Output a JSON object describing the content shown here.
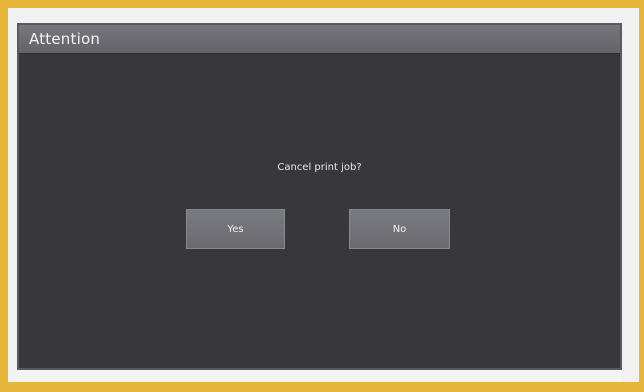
{
  "dialog": {
    "title": "Attention",
    "message": "Cancel print job?",
    "buttons": {
      "yes_label": "Yes",
      "no_label": "No"
    }
  },
  "colors": {
    "frame": "#e6b73b",
    "screen_background": "#38373c",
    "title_bar": "#6c6b72",
    "button_background": "#727279",
    "text": "#f0f0f0"
  }
}
